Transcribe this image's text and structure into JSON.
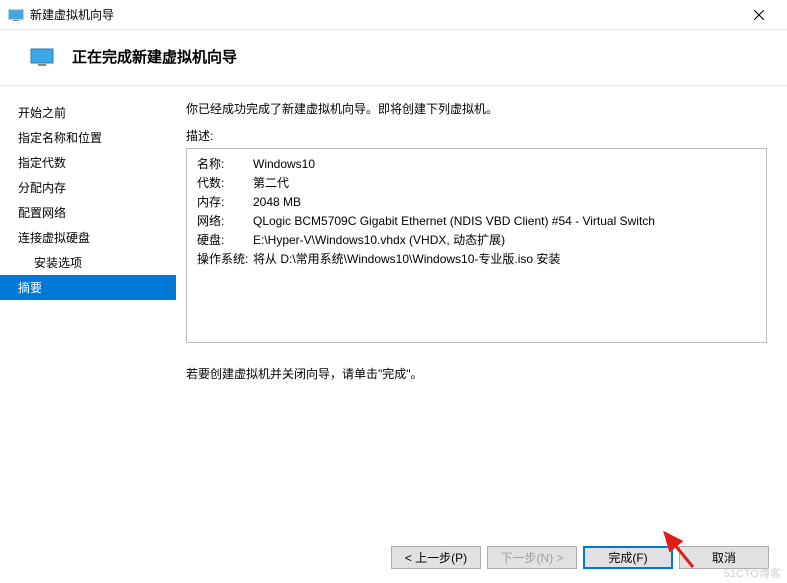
{
  "window": {
    "title": "新建虚拟机向导"
  },
  "header": {
    "heading": "正在完成新建虚拟机向导"
  },
  "sidebar": [
    {
      "label": "开始之前",
      "indent": false
    },
    {
      "label": "指定名称和位置",
      "indent": false
    },
    {
      "label": "指定代数",
      "indent": false
    },
    {
      "label": "分配内存",
      "indent": false
    },
    {
      "label": "配置网络",
      "indent": false
    },
    {
      "label": "连接虚拟硬盘",
      "indent": false
    },
    {
      "label": "安装选项",
      "indent": true
    },
    {
      "label": "摘要",
      "indent": false,
      "selected": true
    }
  ],
  "main": {
    "summary_intro": "你已经成功完成了新建虚拟机向导。即将创建下列虚拟机。",
    "desc_label": "描述:",
    "rows": [
      {
        "key": "名称:",
        "val": "Windows10"
      },
      {
        "key": "代数:",
        "val": "第二代"
      },
      {
        "key": "内存:",
        "val": "2048 MB"
      },
      {
        "key": "网络:",
        "val": "QLogic BCM5709C Gigabit Ethernet (NDIS VBD Client) #54 - Virtual Switch"
      },
      {
        "key": "硬盘:",
        "val": "E:\\Hyper-V\\Windows10.vhdx (VHDX, 动态扩展)"
      },
      {
        "key": "操作系统:",
        "val": "将从 D:\\常用系统\\Windows10\\Windows10-专业版.iso 安装"
      }
    ],
    "finish_hint": "若要创建虚拟机并关闭向导，请单击\"完成\"。"
  },
  "buttons": {
    "prev": "< 上一步(P)",
    "next": "下一步(N) >",
    "finish": "完成(F)",
    "cancel": "取消"
  },
  "watermark": "51CTO博客"
}
